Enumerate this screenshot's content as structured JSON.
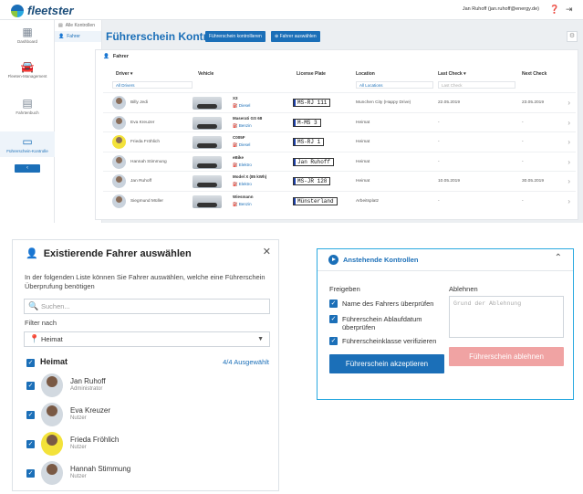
{
  "app": {
    "name": "fleetster",
    "user": "Jan Ruhoff (jan.ruhoff@energy.de)"
  },
  "rail": [
    {
      "label": "Dashboard",
      "icon": "grid-icon"
    },
    {
      "label": "Fleeten-Management",
      "icon": "car-icon"
    },
    {
      "label": "Fahrtenbuch",
      "icon": "book-icon"
    },
    {
      "label": "Führerschein-Kontrolle",
      "icon": "license-icon"
    }
  ],
  "subnav": [
    "Alle Kontrollen",
    "Fahrer"
  ],
  "main": {
    "title": "Führerschein Kontrolle",
    "btn_check": "Führerschein kontrollieren",
    "btn_select": "Fahrer auswählen",
    "card_title": "Fahrer",
    "columns": [
      "Driver",
      "Vehicle",
      "License Plate",
      "Location",
      "Last Check",
      "Next Check"
    ],
    "filters": {
      "driver": "All Drivers",
      "location": "All Locations",
      "last_check": "Last Check"
    },
    "rows": [
      {
        "driver": "Billy Jedi",
        "vehicle": "X3",
        "fuel": "Diesel",
        "plate": "MS-RJ 111",
        "location": "Munchen City (Happy Drive)",
        "last": "22.05.2019",
        "next": "23.05.2019"
      },
      {
        "driver": "Eva Kreuzer",
        "vehicle": "Maserati GS 68",
        "fuel": "Benzin",
        "plate": "M-MS 3",
        "location": "Heimat",
        "last": "-",
        "next": "-"
      },
      {
        "driver": "Frieda Fröhlich",
        "vehicle": "C005F",
        "fuel": "Diesel",
        "plate": "MS-RJ 1",
        "location": "Heimat",
        "last": "-",
        "next": "-"
      },
      {
        "driver": "Hannah Stimmung",
        "vehicle": "eBike",
        "fuel": "Elektro",
        "plate": "Jan Ruhoff",
        "location": "Heimat",
        "last": "-",
        "next": "-"
      },
      {
        "driver": "Jan Ruhoff",
        "vehicle": "Model X (85 kWh)",
        "fuel": "Elektro",
        "plate": "MS-JR 128",
        "location": "Heimat",
        "last": "10.05.2019",
        "next": "30.05.2019"
      },
      {
        "driver": "Siegmund Müller",
        "vehicle": "Wiesmann",
        "fuel": "Benzin",
        "plate": "Münsterland",
        "location": "Arbeitsplatz",
        "last": "-",
        "next": "-"
      }
    ]
  },
  "dialog": {
    "title": "Existierende Fahrer auswählen",
    "description": "In der folgenden Liste können Sie Fahrer auswählen, welche eine Führerschein Überprufung benötigen",
    "search_placeholder": "Suchen...",
    "filter_label": "Filter nach",
    "filter_value": "Heimat",
    "group": "Heimat",
    "count": "4/4 Ausgewählt",
    "people": [
      {
        "name": "Jan Ruhoff",
        "role": "Administrator"
      },
      {
        "name": "Eva Kreuzer",
        "role": "Nutzer"
      },
      {
        "name": "Frieda Fröhlich",
        "role": "Nutzer"
      },
      {
        "name": "Hannah Stimmung",
        "role": "Nutzer"
      }
    ]
  },
  "panel": {
    "title": "Anstehende Kontrollen",
    "approve_label": "Freigeben",
    "reject_label": "Ablehnen",
    "checks": [
      "Name des Fahrers überprüfen",
      "Führerschein Ablaufdatum überprüfen",
      "Führerscheinklasse verifizieren"
    ],
    "reason_placeholder": "Grund der Ablehnung",
    "accept_btn": "Führerschein akzeptieren",
    "reject_btn": "Führerschein ablehnen"
  }
}
